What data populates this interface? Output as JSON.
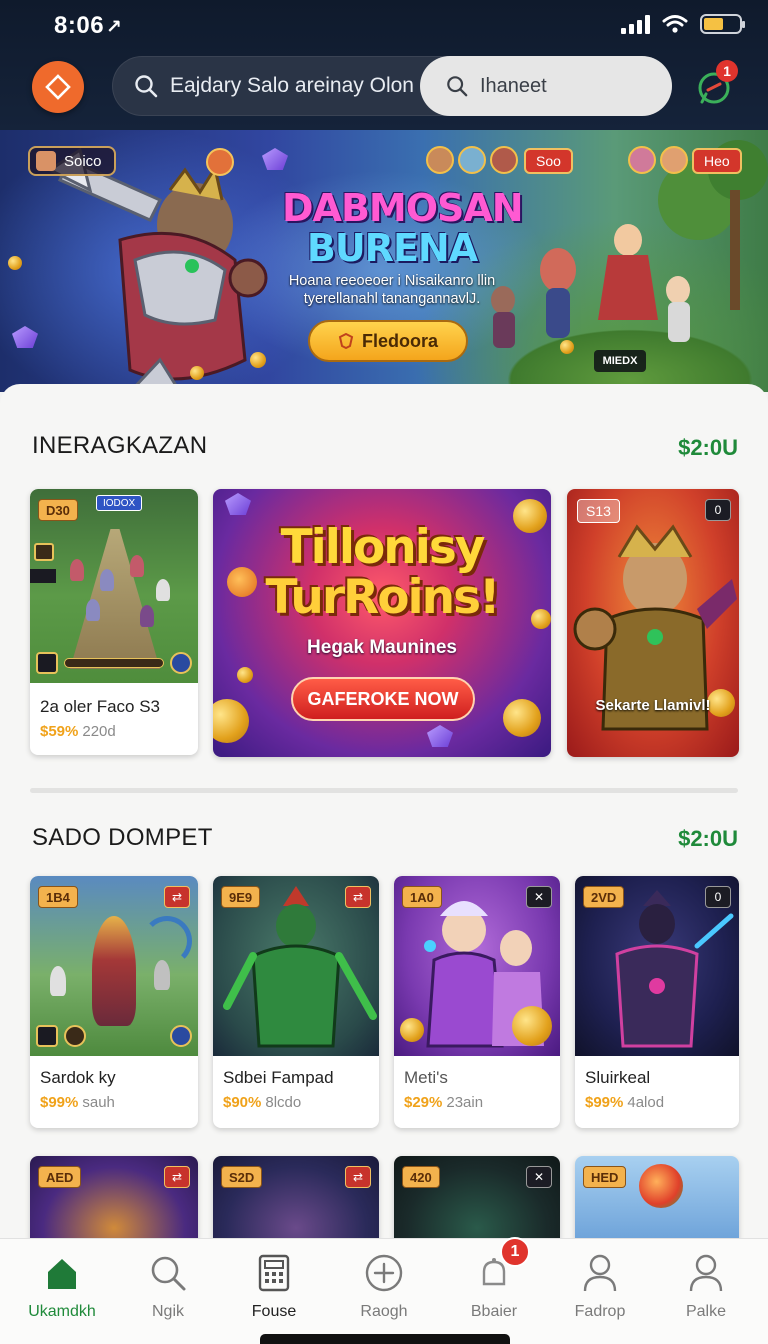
{
  "status": {
    "time": "8:06",
    "time_suffix": "1"
  },
  "header": {
    "logo_icon": "diamond-icon",
    "search_text": "Eajdary Salo areinay Olon",
    "search_pill_text": "Ihaneet",
    "chat_badge": "1"
  },
  "hero": {
    "tag": "Soico",
    "title_line1": "DABMOSAN",
    "title_line2": "BURENA",
    "subtitle": "Hoana reeoeoer i Nisaikanro llin tyerellanahl tanangannavlJ.",
    "cta": "Fledoora",
    "chip_left": "Soo",
    "chip_right": "Heo",
    "mini_label": "MIEDX"
  },
  "section1": {
    "title": "INERAGKAZAN",
    "amount": "$2:0U",
    "small_card": {
      "tag": "D30",
      "name": "2a oler Faco S3",
      "price": "$59%",
      "price_suffix": "220d",
      "top_label": "IODOX"
    },
    "featured": {
      "title_line1": "Tillonisy",
      "title_line2": "TurRoins!",
      "subtitle": "Hegak Maunines",
      "cta": "GAFEROKE NOW"
    },
    "side_card": {
      "tag": "S13",
      "badge": "0",
      "caption": "Sekarte Llamivl!"
    }
  },
  "section2": {
    "title": "SADO DOMPET",
    "amount": "$2:0U",
    "cards": [
      {
        "tag": "1B4",
        "name": "Sardok ky",
        "price": "$99%",
        "suffix": "sauh"
      },
      {
        "tag": "9E9",
        "name": "Sdbei Fampad",
        "price": "$90%",
        "suffix": "8lcdo"
      },
      {
        "tag": "1A0",
        "name": "Meti's",
        "price": "$29%",
        "suffix": "23ain"
      },
      {
        "tag": "2VD",
        "name": "Sluirkeal",
        "price": "$99%",
        "suffix": "4alod"
      }
    ],
    "partial_tags": [
      "AED",
      "S2D",
      "420",
      "HED"
    ]
  },
  "nav": {
    "items": [
      {
        "label": "Ukamdkh",
        "icon": "home-icon"
      },
      {
        "label": "Ngik",
        "icon": "search-icon"
      },
      {
        "label": "Fouse",
        "icon": "calculator-icon"
      },
      {
        "label": "Raogh",
        "icon": "plus-circle-icon"
      },
      {
        "label": "Bbaier",
        "icon": "bell-icon",
        "badge": "1"
      },
      {
        "label": "Fadrop",
        "icon": "user-icon"
      },
      {
        "label": "Palke",
        "icon": "user-icon"
      }
    ]
  },
  "colors": {
    "accent": "#1f8a3a",
    "header": "#15233a",
    "logo": "#ef6a2c",
    "badge": "#e0342d",
    "price": "#f0a21a"
  }
}
